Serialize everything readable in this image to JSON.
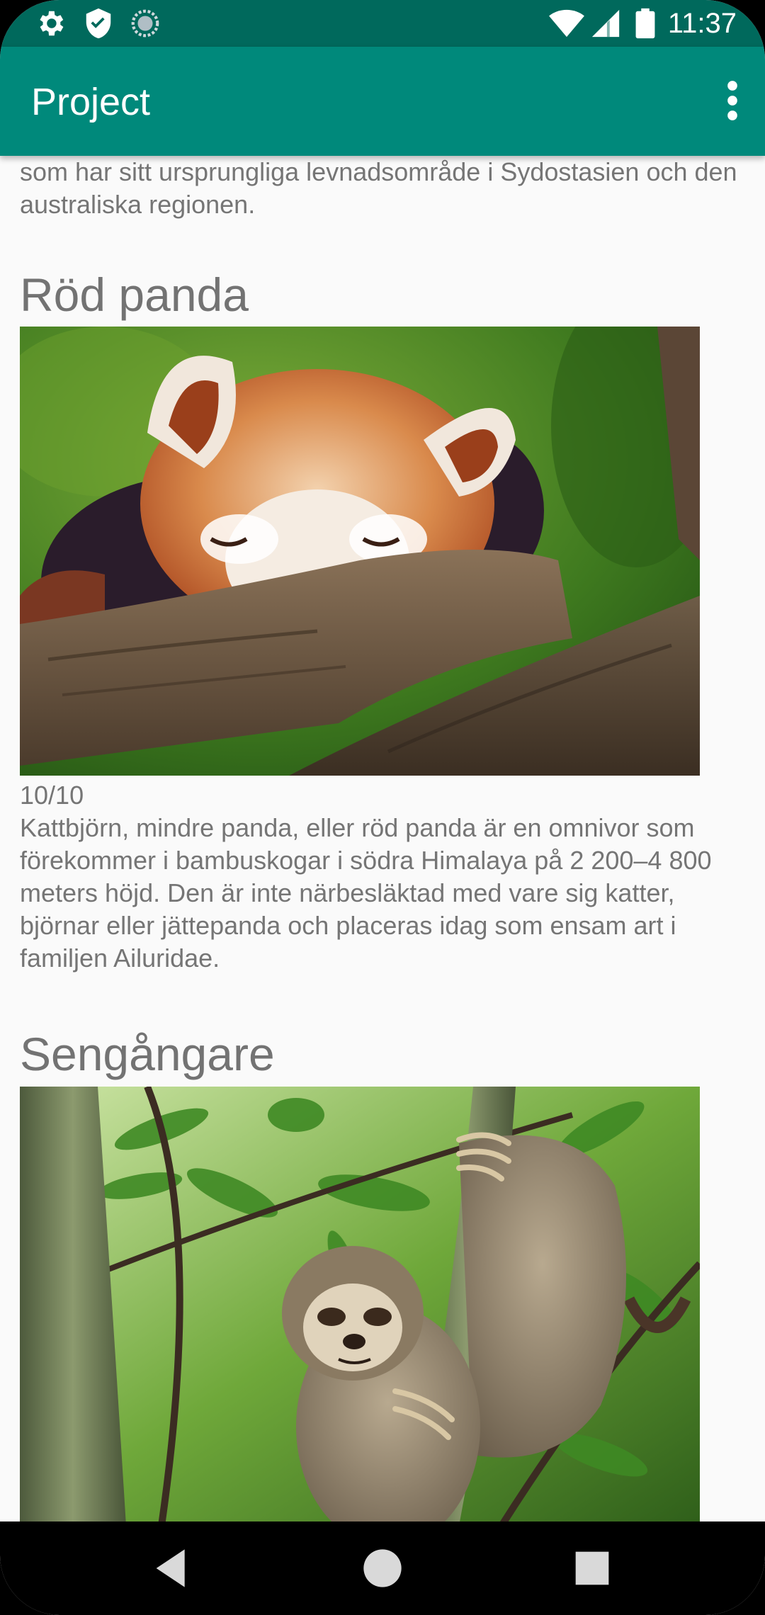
{
  "status_bar": {
    "time": "11:37",
    "icons": [
      "settings-icon",
      "shield-icon",
      "sync-icon",
      "wifi-icon",
      "cell-signal-icon",
      "battery-icon"
    ]
  },
  "app_bar": {
    "title": "Project",
    "overflow_icon": "more-vert-icon"
  },
  "content": {
    "intro_text": "som har sitt ursprungliga levnadsområde i Sydostasien och den australiska regionen.",
    "cards": [
      {
        "title": "Röd panda",
        "image": "red-panda-photo",
        "rating": "10/10",
        "description": "Kattbjörn, mindre panda, eller röd panda är en omnivor som förekommer i bambuskogar i södra Himalaya på 2 200–4 800 meters höjd. Den är inte närbesläktad med vare sig katter, björnar eller jättepanda och placeras idag som ensam art i familjen Ailuridae."
      },
      {
        "title": "Sengångare",
        "image": "sloth-photo"
      }
    ]
  },
  "nav_bar": {
    "icons": [
      "back-icon",
      "home-icon",
      "recents-icon"
    ]
  },
  "colors": {
    "status_bar": "#00695c",
    "app_bar": "#00897b",
    "background": "#fafafa",
    "text": "#757575"
  }
}
